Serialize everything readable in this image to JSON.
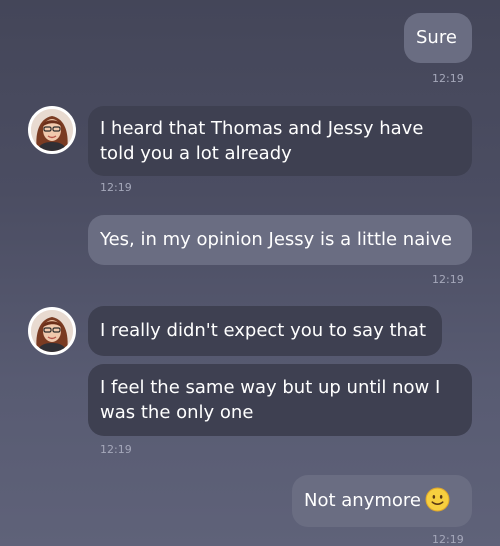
{
  "messages": [
    {
      "text": "Sure",
      "time": "12:19"
    },
    {
      "text_line1": "I heard that Thomas and Jessy have",
      "text_line2": "told you a lot already",
      "time": "12:19"
    },
    {
      "text": "Yes, in my opinion Jessy is a little naive",
      "time": "12:19"
    },
    {
      "text": "I really didn't expect you to say that"
    },
    {
      "text_line1": "I feel the same way but up until now I",
      "text_line2": "was the only one",
      "time": "12:19"
    },
    {
      "text": "Not anymore",
      "emoji": "slightly-smiling-face-icon",
      "time": "12:19"
    }
  ],
  "colors": {
    "incoming_bubble": "#3e4051",
    "outgoing_bubble": "#6a6d82",
    "timestamp": "#a5a8ba",
    "emoji": "#f7cf3f"
  }
}
